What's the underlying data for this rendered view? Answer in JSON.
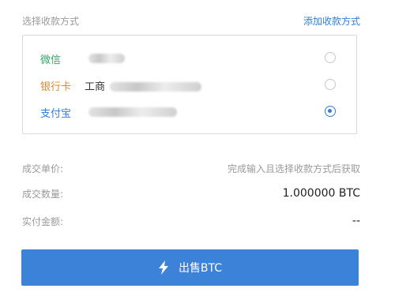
{
  "header": {
    "section_title": "选择收款方式",
    "add_method_label": "添加收款方式"
  },
  "payment_methods": [
    {
      "name": "微信",
      "color": "#3aa36a",
      "account_visible": "",
      "selected": false
    },
    {
      "name": "银行卡",
      "color": "#d98a32",
      "account_visible": "工商",
      "selected": false
    },
    {
      "name": "支付宝",
      "color": "#2e7fd9",
      "account_visible": "",
      "selected": true
    }
  ],
  "details": {
    "unit_price_label": "成交单价:",
    "unit_price_value": "完成输入且选择收款方式后获取",
    "quantity_label": "成交数量:",
    "quantity_value": "1.000000 BTC",
    "amount_label": "实付金额:",
    "amount_value": "--"
  },
  "actions": {
    "sell_label": "出售BTC",
    "sell_icon": "lightning-icon"
  },
  "colors": {
    "accent": "#3c82d8",
    "muted_text": "#9a9a9a"
  }
}
